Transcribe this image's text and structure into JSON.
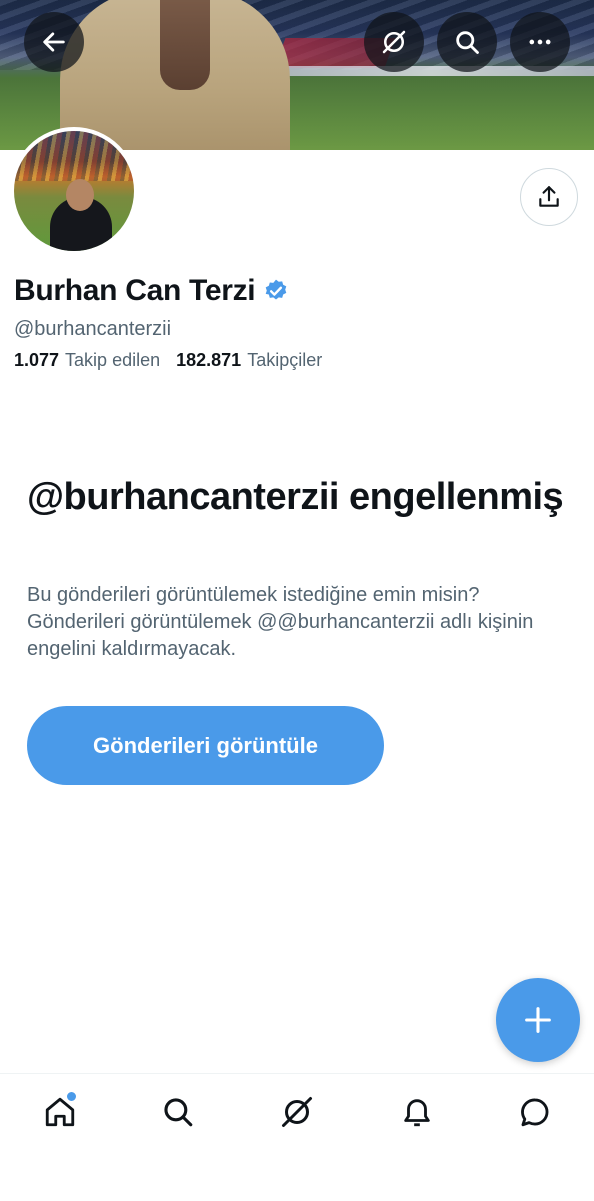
{
  "profile": {
    "name": "Burhan Can Terzi",
    "handle": "@burhancanterzii",
    "following_count": "1.077",
    "following_label": "Takip edilen",
    "followers_count": "182.871",
    "followers_label": "Takipçiler",
    "verified": true
  },
  "blocked": {
    "title": "@burhancanterzii engellenmiş",
    "description": "Bu gönderileri görüntülemek istediğine emin misin? Gönderileri görüntülemek @@burhancanterzii adlı kişinin engelini kaldırmayacak.",
    "button_label": "Gönderileri görüntüle"
  },
  "header_icons": [
    "back-arrow-icon",
    "grok-icon",
    "search-icon",
    "more-icon"
  ],
  "nav_icons": [
    "home-icon",
    "search-icon",
    "grok-icon",
    "bell-icon",
    "messages-icon"
  ],
  "colors": {
    "accent": "#4a9ae9",
    "text": "#0f1419",
    "secondary": "#536471"
  }
}
